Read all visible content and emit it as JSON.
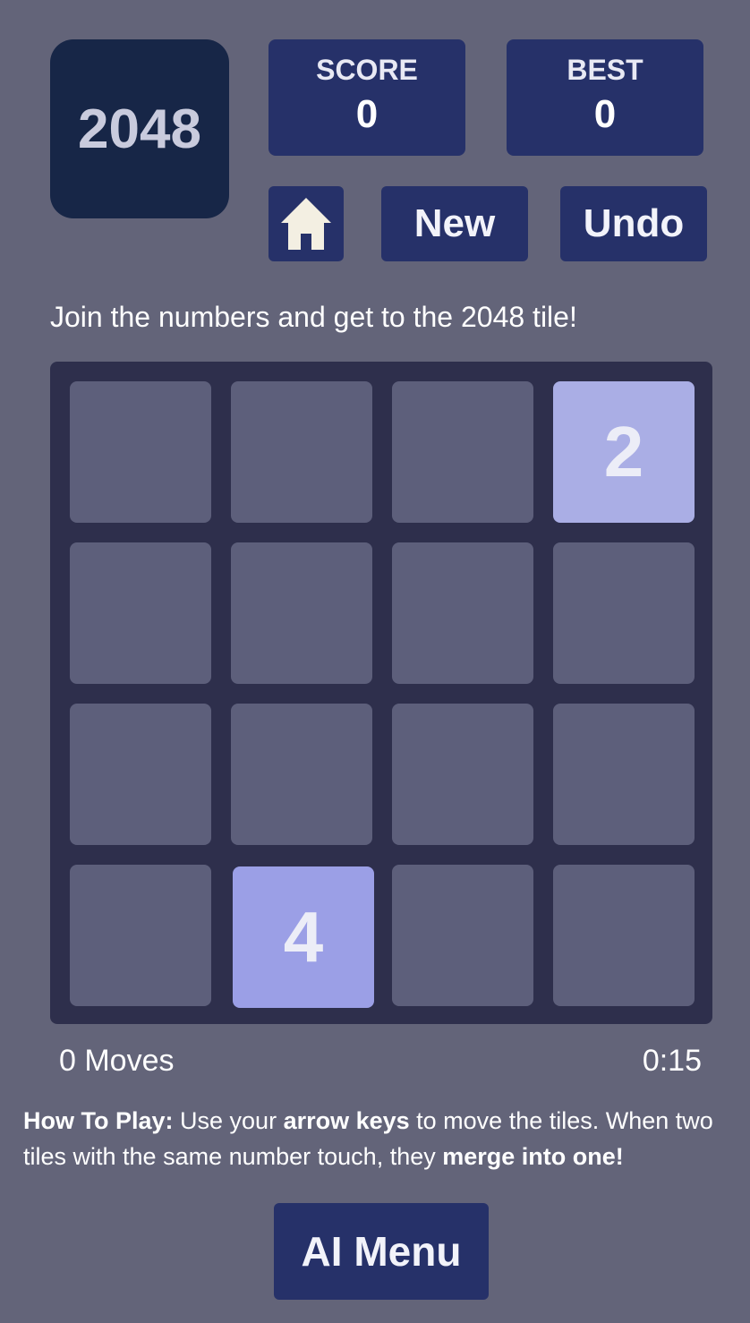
{
  "logo": {
    "text": "2048"
  },
  "score": {
    "label": "SCORE",
    "value": "0"
  },
  "best": {
    "label": "BEST",
    "value": "0"
  },
  "buttons": {
    "home_icon": "home-icon",
    "new_label": "New",
    "undo_label": "Undo"
  },
  "tagline": "Join the numbers and get to the 2048 tile!",
  "board": {
    "rows": [
      [
        "",
        "",
        "",
        "2"
      ],
      [
        "",
        "",
        "",
        ""
      ],
      [
        "",
        "",
        "",
        ""
      ],
      [
        "",
        "4",
        "",
        ""
      ]
    ]
  },
  "status": {
    "moves": "0 Moves",
    "time": "0:15"
  },
  "howto": {
    "title": "How To Play:",
    "text1": " Use your ",
    "bold1": "arrow keys",
    "text2": " to move the tiles. When two tiles with the same number touch, they ",
    "bold2": "merge into one!"
  },
  "ai_menu": {
    "label": "AI Menu"
  },
  "colors": {
    "background": "#636479",
    "panel": "#263169",
    "board": "#2e2f4c",
    "empty_cell": "#5d5f7b",
    "tile_2": "#aaaee5",
    "tile_4": "#9b9fe6"
  }
}
